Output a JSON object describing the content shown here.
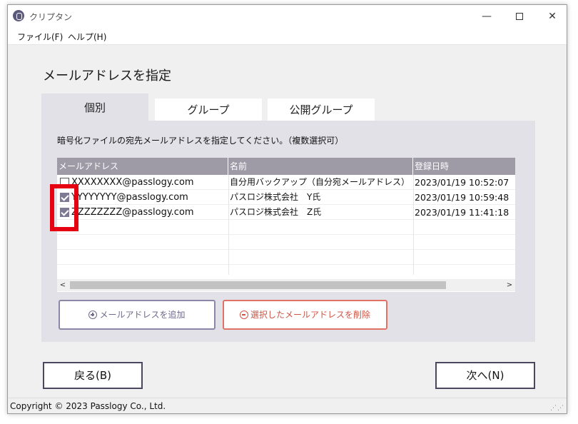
{
  "window": {
    "title": "クリプタン",
    "minimize_glyph": "—",
    "close_glyph": "✕"
  },
  "menu": {
    "file": "ファイル(F)",
    "help": "ヘルプ(H)"
  },
  "heading": "メールアドレスを指定",
  "tabs": [
    {
      "label": "個別",
      "active": true
    },
    {
      "label": "グループ",
      "active": false
    },
    {
      "label": "公開グループ",
      "active": false
    }
  ],
  "instruction": "暗号化ファイルの宛先メールアドレスを指定してください。（複数選択可）",
  "table": {
    "columns": [
      "メールアドレス",
      "名前",
      "登録日時"
    ],
    "rows": [
      {
        "email": "XXXXXXXX@passlogy.com",
        "name": "自分用バックアップ（自分宛メールアドレス）",
        "date": "2023/01/19 10:52:07",
        "checked": false
      },
      {
        "email": "YYYYYYYY@passlogy.com",
        "name": "パスロジ株式会社　Y氏",
        "date": "2023/01/19 10:59:48",
        "checked": true
      },
      {
        "email": "ZZZZZZZZ@passlogy.com",
        "name": "パスロジ株式会社　Z氏",
        "date": "2023/01/19 11:41:18",
        "checked": true
      }
    ],
    "scroll_left": "<",
    "scroll_right": ">"
  },
  "buttons": {
    "add": "メールアドレスを追加",
    "delete": "選択したメールアドレスを削除",
    "back": "戻る(B)",
    "next": "次へ(N)"
  },
  "status": {
    "copyright": "Copyright © 2023 Passlogy Co., Ltd.",
    "grip": "⋰⋰"
  },
  "colors": {
    "accent": "#7f7a94",
    "highlight": "#e50012",
    "delete": "#e07365"
  }
}
